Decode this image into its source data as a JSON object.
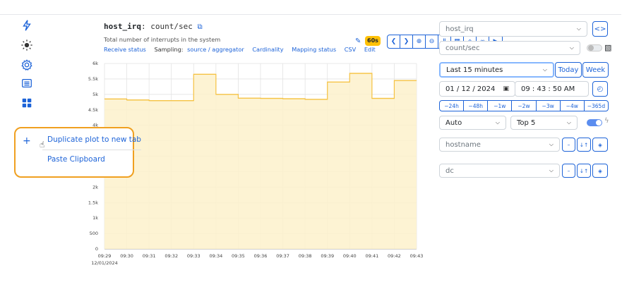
{
  "plot": {
    "metric": "host_irq",
    "unit": ": count/sec",
    "description": "Total number of interrupts in the system",
    "links": {
      "receive_status": "Receive status",
      "sampling_label": "Sampling:",
      "sampling_value": "source / aggregator",
      "cardinality": "Cardinality",
      "mapping_status": "Mapping status",
      "csv": "CSV",
      "edit": "Edit"
    },
    "refresh_badge": "60s"
  },
  "context_menu": {
    "duplicate": "Duplicate plot to new tab",
    "paste": "Paste Clipboard"
  },
  "sidebar": {
    "plus": "+"
  },
  "chart_data": {
    "type": "area",
    "x": [
      "09:29",
      "09:30",
      "09:31",
      "09:32",
      "09:33",
      "09:34",
      "09:35",
      "09:36",
      "09:37",
      "09:38",
      "09:39",
      "09:40",
      "09:41",
      "09:42"
    ],
    "values": [
      4850,
      4820,
      4800,
      4800,
      5650,
      5000,
      4880,
      4870,
      4860,
      4840,
      5400,
      5680,
      4870,
      5450
    ],
    "x_ticks": [
      "09:29",
      "09:30",
      "09:31",
      "09:32",
      "09:33",
      "09:34",
      "09:35",
      "09:36",
      "09:37",
      "09:38",
      "09:39",
      "09:40",
      "09:41",
      "09:42",
      "09:43"
    ],
    "x_date": "12/01/2024",
    "y_ticks": [
      "0",
      "500",
      "1k",
      "1.5k",
      "2k",
      "2.5k",
      "3k",
      "3.5k",
      "4k",
      "4.5k",
      "5k",
      "5.5k",
      "6k"
    ],
    "ylim": [
      0,
      6000
    ],
    "grid": true,
    "fill_color": "#fdf1cb",
    "line_color": "#f5c242"
  },
  "right_panel": {
    "metric_select": "host_irq",
    "unit_select": "count/sec",
    "time_range": "Last 15 minutes",
    "today": "Today",
    "week": "Week",
    "date": "01 / 12 / 2024",
    "time": "09 : 43 : 50  AM",
    "shifts": [
      "−24h",
      "−48h",
      "−1w",
      "−2w",
      "−3w",
      "−4w",
      "−365d"
    ],
    "resolution": "Auto",
    "top": "Top 5",
    "group1": "hostname",
    "group2": "dc",
    "minus": "–",
    "sort": "↓↑",
    "accent": "#1d63d8"
  }
}
